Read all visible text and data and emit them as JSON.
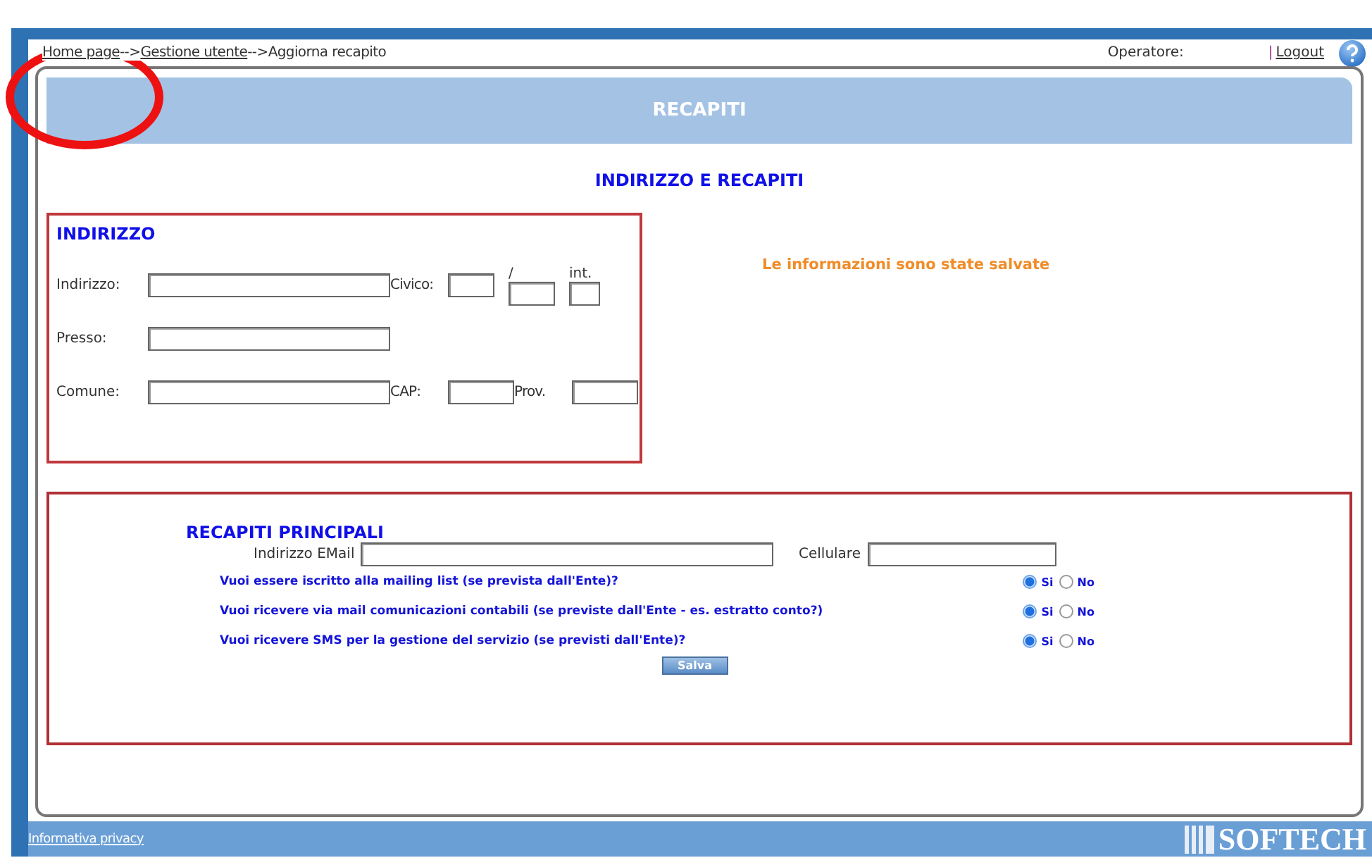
{
  "breadcrumb": [
    {
      "label": "Home page",
      "link": true
    },
    {
      "label": "-->",
      "link": false
    },
    {
      "label": "Gestione utente",
      "link": true
    },
    {
      "label": "-->Aggiorna recapito",
      "link": false
    }
  ],
  "operator_label": "Operatore:",
  "separator": "|",
  "logout": "Logout",
  "header": {
    "title": "RECAPITI"
  },
  "section_title": "INDIRIZZO E RECAPITI",
  "address": {
    "title": "INDIRIZZO",
    "rows": [
      {
        "label": "Indirizzo:",
        "extras": [
          {
            "label": "Civico:",
            "kind": "inline"
          },
          {
            "label": "/",
            "kind": "stacked"
          },
          {
            "label": "int.",
            "kind": "stacked"
          }
        ]
      },
      {
        "label": "Presso:",
        "extras": []
      },
      {
        "label": "Comune:",
        "extras": [
          {
            "label": "CAP:",
            "kind": "inline"
          },
          {
            "label": "Prov.",
            "kind": "inline"
          }
        ]
      }
    ]
  },
  "message": "Le informazioni sono state salvate",
  "contacts": {
    "title": "RECAPITI PRINCIPALI",
    "email_label": "Indirizzo EMail",
    "mobile_label": "Cellulare",
    "questions": [
      {
        "text": "Vuoi essere iscritto alla mailing list (se prevista dall'Ente)?",
        "options": [
          {
            "label": "Si",
            "selected": true
          },
          {
            "label": "No",
            "selected": false
          }
        ]
      },
      {
        "text": "Vuoi ricevere via mail comunicazioni contabili (se previste dall'Ente - es. estratto conto?)",
        "options": [
          {
            "label": "Si",
            "selected": true
          },
          {
            "label": "No",
            "selected": false
          }
        ]
      },
      {
        "text": "Vuoi ricevere SMS per la gestione del servizio (se previsti dall'Ente)?",
        "options": [
          {
            "label": "Si",
            "selected": true
          },
          {
            "label": "No",
            "selected": false
          }
        ]
      }
    ],
    "save_button": "Salva"
  },
  "footer": {
    "privacy_link": "Informativa privacy",
    "logo": "SOFTECH"
  }
}
